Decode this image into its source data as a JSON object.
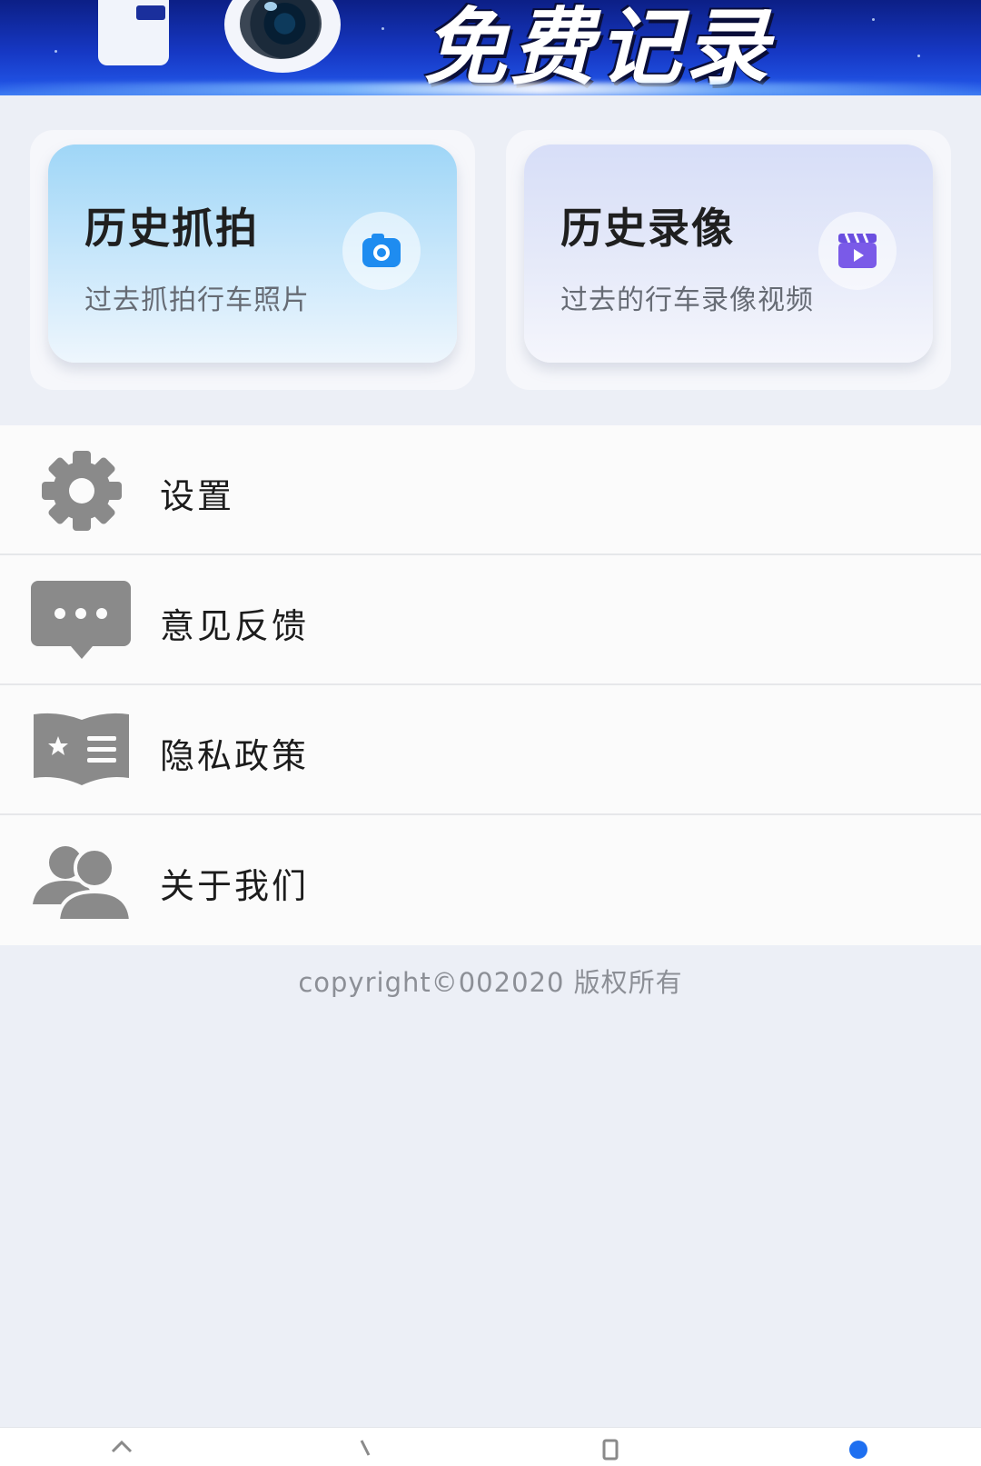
{
  "banner": {
    "title": "免费记录"
  },
  "cards": [
    {
      "title": "历史抓拍",
      "subtitle": "过去抓拍行车照片",
      "icon": "camera-icon"
    },
    {
      "title": "历史录像",
      "subtitle": "过去的行车录像视频",
      "icon": "video-icon"
    }
  ],
  "menu": {
    "items": [
      {
        "label": "设置",
        "icon": "gear-icon"
      },
      {
        "label": "意见反馈",
        "icon": "chat-icon"
      },
      {
        "label": "隐私政策",
        "icon": "book-icon"
      },
      {
        "label": "关于我们",
        "icon": "people-icon"
      }
    ]
  },
  "footer": {
    "copyright": "copyright©002020 版权所有"
  },
  "colors": {
    "accent": "#1e6ff0",
    "icon_gray": "#8a8a8a"
  }
}
